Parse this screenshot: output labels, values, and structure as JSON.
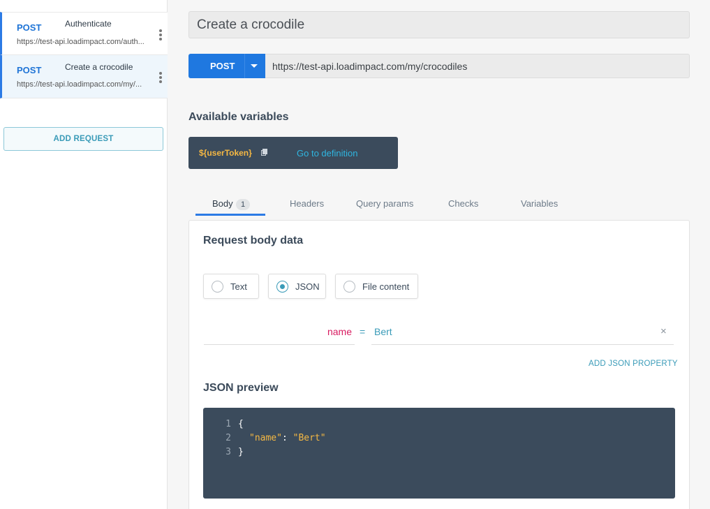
{
  "sidebar": {
    "requests": [
      {
        "method": "POST",
        "name": "Authenticate",
        "url": "https://test-api.loadimpact.com/auth..."
      },
      {
        "method": "POST",
        "name": "Create a crocodile",
        "url": "https://test-api.loadimpact.com/my/..."
      }
    ],
    "add_request_label": "ADD REQUEST"
  },
  "request": {
    "title": "Create a crocodile",
    "method": "POST",
    "url": "https://test-api.loadimpact.com/my/crocodiles"
  },
  "variables": {
    "heading": "Available variables",
    "items": [
      {
        "name": "${userToken}",
        "link_label": "Go to definition"
      }
    ]
  },
  "tabs": [
    {
      "label": "Body",
      "badge": "1",
      "active": true
    },
    {
      "label": "Headers"
    },
    {
      "label": "Query params"
    },
    {
      "label": "Checks"
    },
    {
      "label": "Variables"
    }
  ],
  "body": {
    "heading": "Request body data",
    "types": [
      {
        "label": "Text",
        "selected": false
      },
      {
        "label": "JSON",
        "selected": true
      },
      {
        "label": "File content",
        "selected": false
      }
    ],
    "properties": [
      {
        "key": "name",
        "equals": "=",
        "value": "Bert",
        "remove": "×"
      }
    ],
    "add_property_label": "ADD JSON PROPERTY",
    "preview_heading": "JSON preview",
    "preview_lines": [
      {
        "num": "1",
        "text": "{"
      },
      {
        "num": "2",
        "key": "\"name\"",
        "colon": ": ",
        "value": "\"Bert\""
      },
      {
        "num": "3",
        "text": "}"
      }
    ]
  },
  "colors": {
    "accent": "#1f78e0",
    "teal": "#3a9bb8",
    "dark_panel": "#3b4b5c",
    "variable_yellow": "#f5b843",
    "key_pink": "#d81b60"
  }
}
